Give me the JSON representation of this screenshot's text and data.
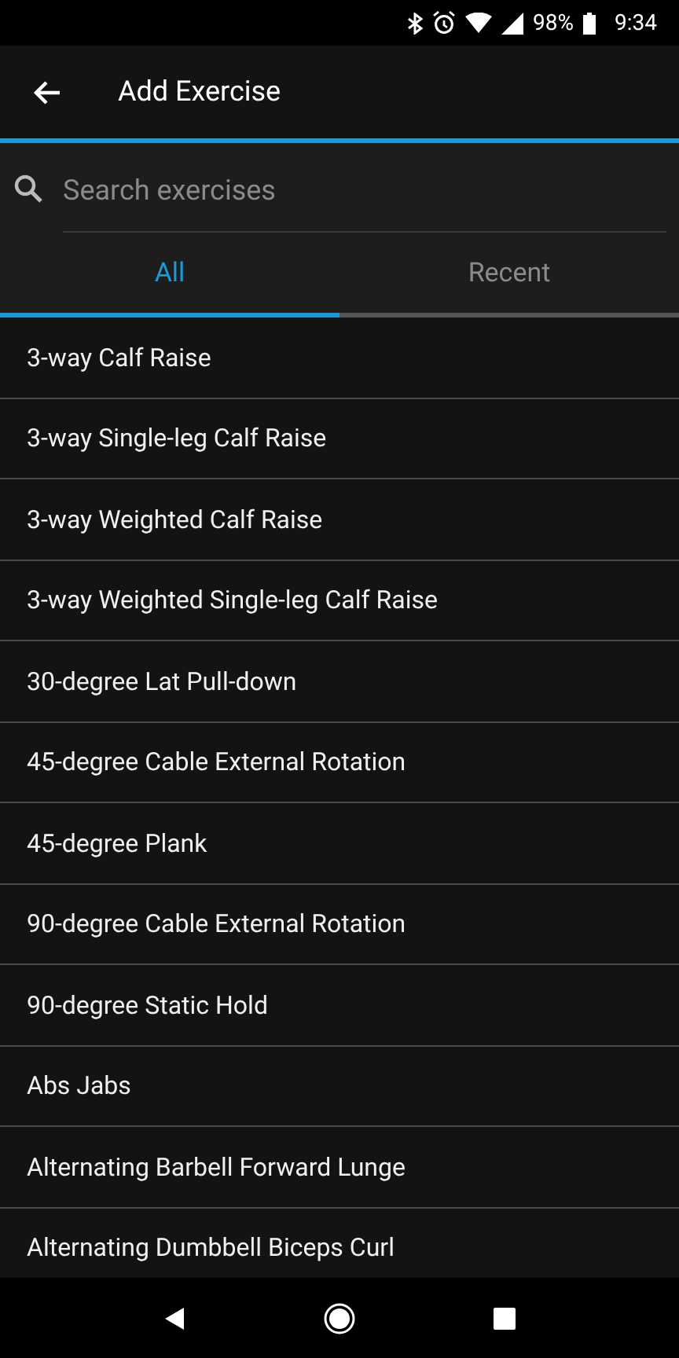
{
  "status_bar": {
    "battery": "98%",
    "time": "9:34"
  },
  "app_bar": {
    "title": "Add Exercise"
  },
  "search": {
    "placeholder": "Search exercises"
  },
  "tabs": [
    {
      "label": "All",
      "selected": true
    },
    {
      "label": "Recent",
      "selected": false
    }
  ],
  "exercises": [
    "3-way Calf Raise",
    "3-way Single-leg Calf Raise",
    "3-way Weighted Calf Raise",
    "3-way Weighted Single-leg Calf Raise",
    "30-degree Lat Pull-down",
    "45-degree Cable External Rotation",
    "45-degree Plank",
    "90-degree Cable External Rotation",
    "90-degree Static Hold",
    "Abs Jabs",
    "Alternating Barbell Forward Lunge",
    "Alternating Dumbbell Biceps Curl"
  ]
}
